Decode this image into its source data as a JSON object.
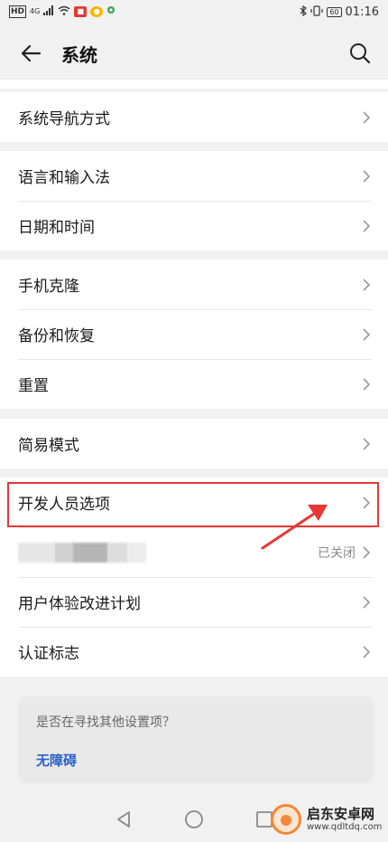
{
  "status_bar": {
    "left_icons": [
      "hd-icon",
      "signal-icon",
      "wifi-icon",
      "app-badge-icon",
      "app-badge-icon",
      "location-icon"
    ],
    "network": "4G",
    "battery": "60",
    "time": "01:16"
  },
  "header": {
    "title": "系统"
  },
  "groups": [
    {
      "items": [
        {
          "label": "系统导航方式"
        }
      ]
    },
    {
      "items": [
        {
          "label": "语言和输入法"
        },
        {
          "label": "日期和时间"
        }
      ]
    },
    {
      "items": [
        {
          "label": "手机克隆"
        },
        {
          "label": "备份和恢复"
        },
        {
          "label": "重置"
        }
      ]
    },
    {
      "items": [
        {
          "label": "简易模式"
        }
      ]
    },
    {
      "items": [
        {
          "label": "开发人员选项"
        },
        {
          "label": "",
          "status": "已关闭"
        },
        {
          "label": "用户体验改进计划"
        },
        {
          "label": "认证标志"
        }
      ]
    }
  ],
  "suggestion": {
    "question": "是否在寻找其他设置项？",
    "link": "无障碍"
  },
  "watermark": {
    "name": "启东安卓网",
    "url": "www.qdltdq.com"
  },
  "colors": {
    "background": "#f1f1f1",
    "highlight": "#e53935",
    "link": "#2962c9"
  }
}
